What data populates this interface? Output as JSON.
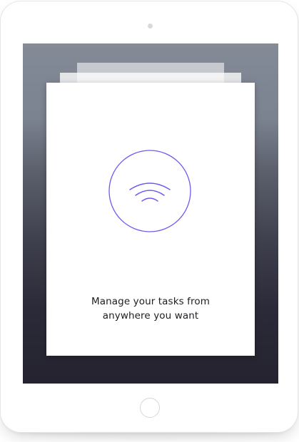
{
  "card": {
    "line1": "Manage your tasks from",
    "line2": "anywhere you want"
  },
  "icons": {
    "card_icon": "wifi-icon",
    "accent_color": "#6b5cf0"
  }
}
